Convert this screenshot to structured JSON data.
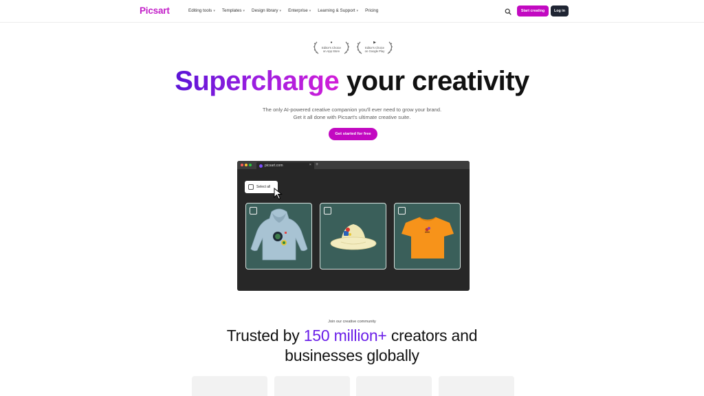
{
  "header": {
    "logo": "Picsart",
    "nav": [
      {
        "label": "Editing tools",
        "has_caret": true
      },
      {
        "label": "Templates",
        "has_caret": true
      },
      {
        "label": "Design library",
        "has_caret": true
      },
      {
        "label": "Enterprise",
        "has_caret": true
      },
      {
        "label": "Learning & Support",
        "has_caret": true
      },
      {
        "label": "Pricing",
        "has_caret": false
      }
    ],
    "search_icon": "search-icon",
    "start_label": "Start creating",
    "login_label": "Log in",
    "colors": {
      "accent": "#c209c1",
      "dark": "#1f2533"
    }
  },
  "awards": [
    {
      "line1": "Editor's Choice",
      "line2": "on App Store",
      "icon": "apple-icon"
    },
    {
      "line1": "Editor's Choice",
      "line2": "on Google Play",
      "icon": "play-icon"
    }
  ],
  "hero": {
    "title_gradient": "Supercharge",
    "title_rest": " your creativity",
    "subtitle": "The only AI-powered creative companion you'll ever need to grow your brand. Get it all done with Picsart's ultimate creative suite.",
    "cta": "Get started for free"
  },
  "browser": {
    "tab_label": "picsart.com",
    "select_all": "Select all",
    "cards": [
      {
        "name": "hoodie",
        "image": "light-blue-hoodie"
      },
      {
        "name": "bucket-hat",
        "image": "cream-bucket-hat"
      },
      {
        "name": "t-shirt",
        "image": "orange-t-shirt"
      }
    ]
  },
  "community": {
    "kicker": "Join our creative community",
    "line1_pre": "Trusted by ",
    "line1_accent": "150 million+",
    "line1_post": " creators and",
    "line2": "businesses globally"
  }
}
